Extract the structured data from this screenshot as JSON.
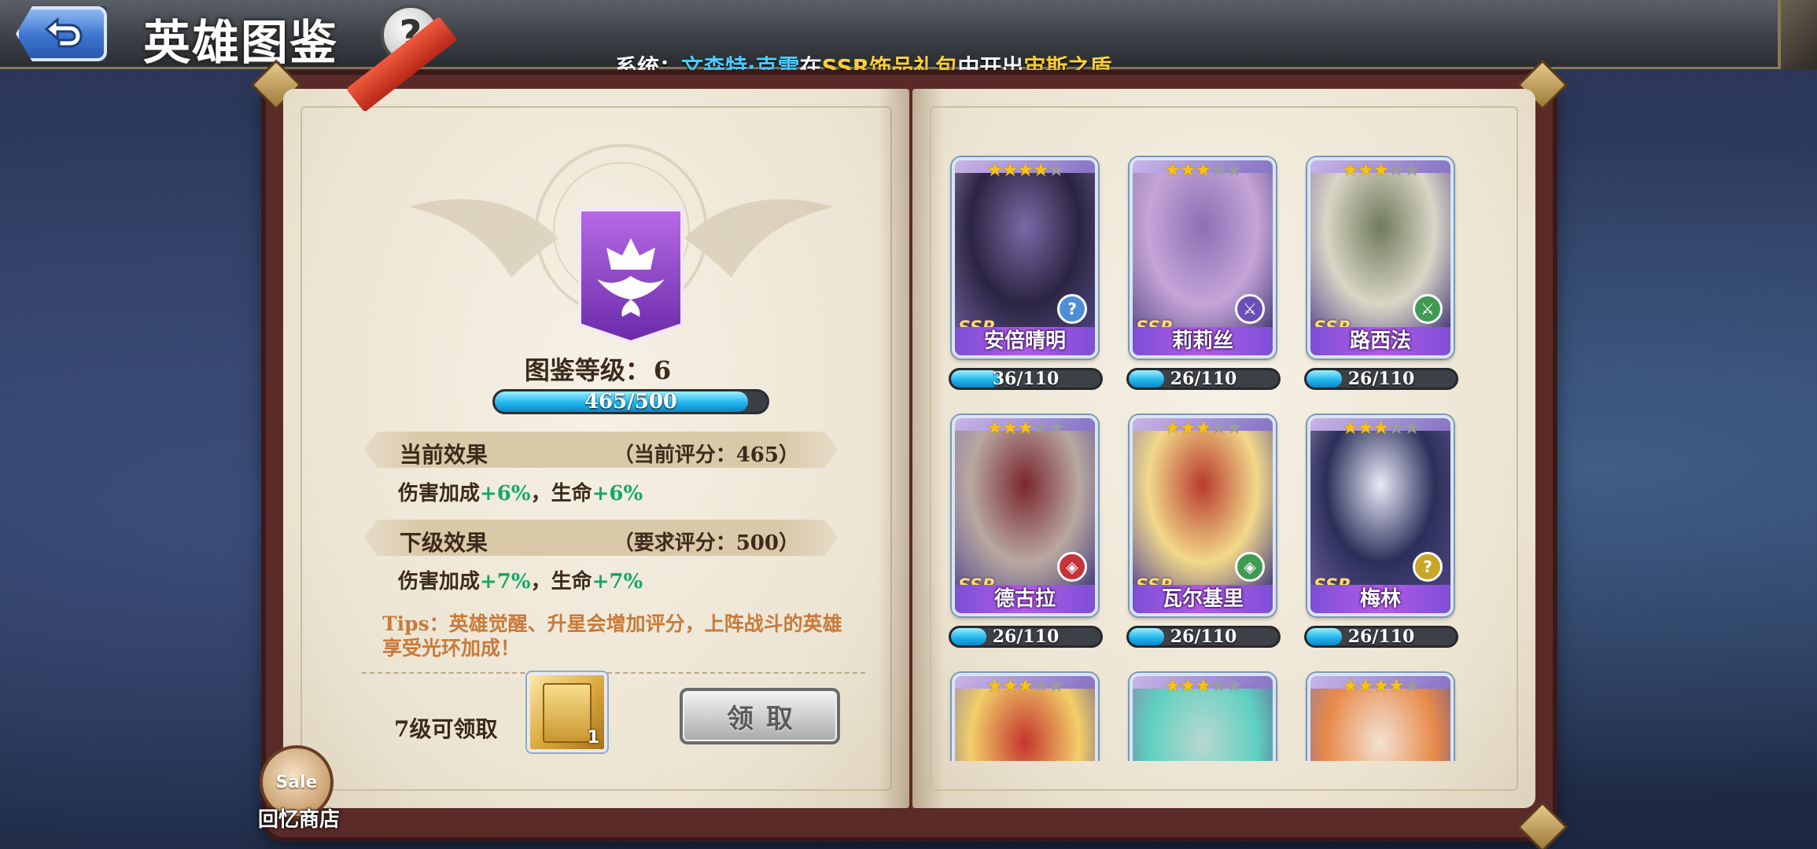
{
  "header": {
    "back_icon": "back-arrow-icon",
    "title": "英雄图鉴",
    "help_label": "?",
    "system_message": {
      "prefix": "系统：",
      "player": "文森特·克雷",
      "mid1": "在",
      "package": "SSR饰品礼包",
      "mid2": "中开出",
      "item": "宙斯之盾"
    }
  },
  "collection": {
    "emblem_icon": "crown-wings-banner-icon",
    "level_label": "图鉴等级：",
    "level_value": "6",
    "xp_text": "465/500",
    "xp_progress": 0.93,
    "current": {
      "title": "当前效果",
      "score": "（当前评分：465）",
      "effect_part1": "伤害加成",
      "effect_val1": "+6%",
      "effect_sep": "，生命",
      "effect_val2": "+6%"
    },
    "next": {
      "title": "下级效果",
      "score": "（要求评分：500）",
      "effect_part1": "伤害加成",
      "effect_val1": "+7%",
      "effect_sep": "，生命",
      "effect_val2": "+7%"
    },
    "tips": "Tips：英雄觉醒、升星会增加评分，上阵战斗的英雄享受光环加成！",
    "reward": {
      "label": "7级可领取",
      "item_count": "1",
      "claim_label": "领取"
    }
  },
  "shop": {
    "badge_text": "Sale",
    "label": "回忆商店"
  },
  "heroes": [
    {
      "name": "安倍晴明",
      "rarity": "SSR",
      "stars": 4,
      "max_stars": 5,
      "progress_text": "36/110",
      "progress": 0.327,
      "class_icon": "question-class-icon",
      "class_color": "#4c8fd6",
      "colors": [
        "#2b2440",
        "#7a6aa8"
      ]
    },
    {
      "name": "莉莉丝",
      "rarity": "SSR",
      "stars": 3,
      "max_stars": 5,
      "progress_text": "26/110",
      "progress": 0.236,
      "class_icon": "swords-class-icon",
      "class_color": "#6a4fb8",
      "colors": [
        "#c6a4d8",
        "#8c6fb4"
      ]
    },
    {
      "name": "路西法",
      "rarity": "SSR",
      "stars": 3,
      "max_stars": 5,
      "progress_text": "26/110",
      "progress": 0.236,
      "class_icon": "swords-class-icon",
      "class_color": "#3f9a52",
      "colors": [
        "#d9d6c6",
        "#6f7a5a"
      ]
    },
    {
      "name": "德古拉",
      "rarity": "SSR",
      "stars": 3,
      "max_stars": 5,
      "progress_text": "26/110",
      "progress": 0.236,
      "class_icon": "shield-class-icon",
      "class_color": "#c6343a",
      "colors": [
        "#b8a8a0",
        "#7a2630"
      ]
    },
    {
      "name": "瓦尔基里",
      "rarity": "SSR",
      "stars": 3,
      "max_stars": 5,
      "progress_text": "26/110",
      "progress": 0.236,
      "class_icon": "shield-class-icon",
      "class_color": "#3f9a52",
      "colors": [
        "#f2d98a",
        "#b83a2e"
      ]
    },
    {
      "name": "梅林",
      "rarity": "SSR",
      "stars": 3,
      "max_stars": 5,
      "progress_text": "26/110",
      "progress": 0.236,
      "class_icon": "question-class-icon",
      "class_color": "#c9a52a",
      "colors": [
        "#2a2f5a",
        "#e8eaf6"
      ]
    },
    {
      "name": "",
      "rarity": "",
      "stars": 3,
      "max_stars": 5,
      "colors": [
        "#f2cf6a",
        "#c4352e"
      ]
    },
    {
      "name": "",
      "rarity": "",
      "stars": 3,
      "max_stars": 5,
      "colors": [
        "#5fd0c0",
        "#b8d8d0"
      ]
    },
    {
      "name": "",
      "rarity": "",
      "stars": 4,
      "max_stars": 5,
      "colors": [
        "#e88a4a",
        "#f2e2d4"
      ]
    }
  ]
}
